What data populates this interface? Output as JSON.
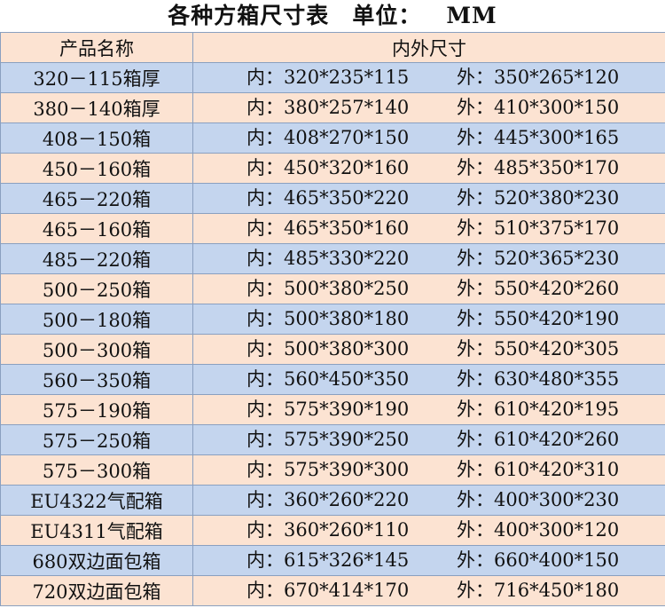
{
  "title": {
    "main": "各种方箱尺寸表",
    "unit_label": "单位：",
    "unit_value": "MM"
  },
  "table": {
    "headers": [
      "产品名称",
      "内外尺寸"
    ],
    "rows": [
      {
        "name": "320－115箱厚",
        "inner": "内：320*235*115",
        "outer": "外：350*265*120"
      },
      {
        "name": "380－140箱厚",
        "inner": "内：380*257*140",
        "outer": "外：410*300*150"
      },
      {
        "name": "408－150箱",
        "inner": "内：408*270*150",
        "outer": "外：445*300*165"
      },
      {
        "name": "450－160箱",
        "inner": "内：450*320*160",
        "outer": "外：485*350*170"
      },
      {
        "name": "465－220箱",
        "inner": "内：465*350*220",
        "outer": "外：520*380*230"
      },
      {
        "name": "465－160箱",
        "inner": "内：465*350*160",
        "outer": "外：510*375*170"
      },
      {
        "name": "485－220箱",
        "inner": "内：485*330*220",
        "outer": "外：520*365*230"
      },
      {
        "name": "500－250箱",
        "inner": "内：500*380*250",
        "outer": "外：550*420*260"
      },
      {
        "name": "500－180箱",
        "inner": "内：500*380*180",
        "outer": "外：550*420*190"
      },
      {
        "name": "500－300箱",
        "inner": "内：500*380*300",
        "outer": "外：550*420*305"
      },
      {
        "name": "560－350箱",
        "inner": "内：560*450*350",
        "outer": "外：630*480*355"
      },
      {
        "name": "575－190箱",
        "inner": "内：575*390*190",
        "outer": "外：610*420*195"
      },
      {
        "name": "575－250箱",
        "inner": "内：575*390*250",
        "outer": "外：610*420*260"
      },
      {
        "name": "575－300箱",
        "inner": "内：575*390*300",
        "outer": "外：610*420*310"
      },
      {
        "name": "EU4322气配箱",
        "inner": "内：360*260*220",
        "outer": "外：400*300*230"
      },
      {
        "name": "EU4311气配箱",
        "inner": "内：360*260*110",
        "outer": "外：400*300*120"
      },
      {
        "name": "680双边面包箱",
        "inner": "内：615*326*145",
        "outer": "外：660*400*150"
      },
      {
        "name": "720双边面包箱",
        "inner": "内：670*414*170",
        "outer": "外：716*450*180"
      }
    ]
  },
  "colors": {
    "row_blue": "#c4d5ee",
    "row_peach": "#fce3d2",
    "grid_line": "#8aa0c0"
  }
}
